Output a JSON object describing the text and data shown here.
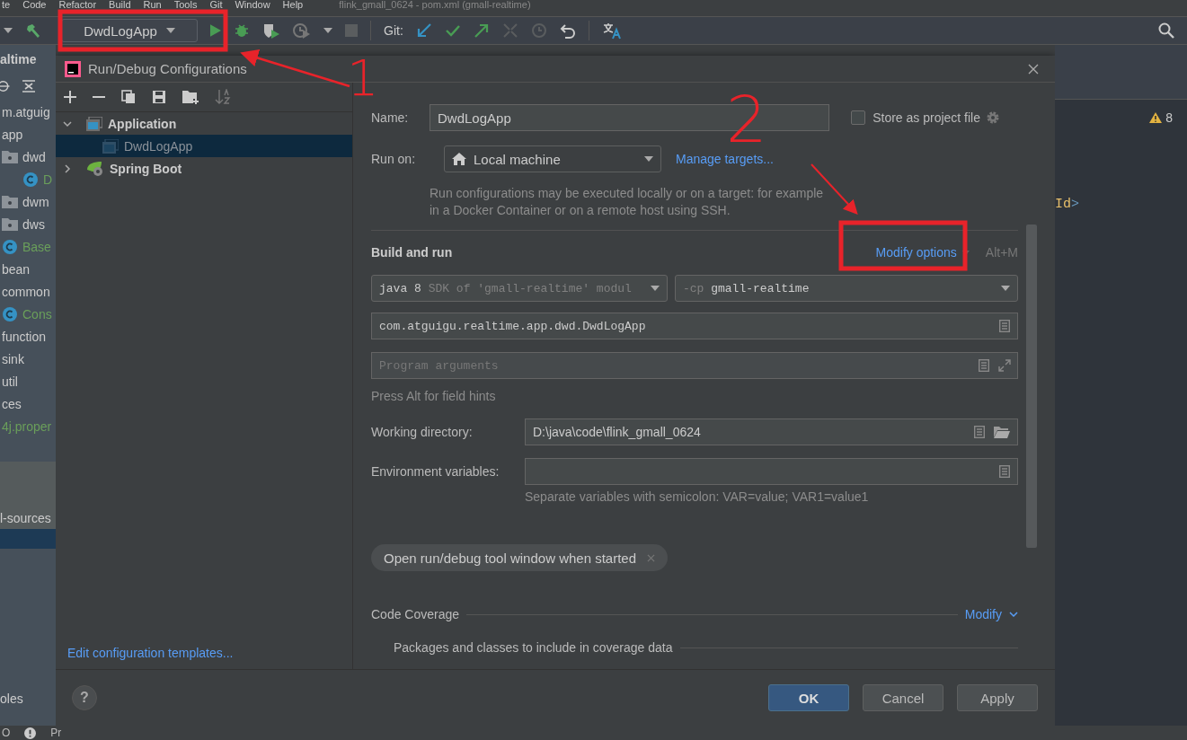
{
  "menu_bar": {
    "items": [
      "te",
      "Code",
      "Refactor",
      "Build",
      "Run",
      "Tools",
      "Git",
      "Window",
      "Help"
    ],
    "title": "flink_gmall_0624 - pom.xml (gmall-realtime)"
  },
  "toolbar": {
    "run_configuration": "DwdLogApp",
    "git_label": "Git:"
  },
  "project_panel": {
    "breadcrumb": "altime",
    "items": [
      {
        "label": "m.atguig",
        "kind": "package"
      },
      {
        "label": "app",
        "kind": "package"
      },
      {
        "label": "dwd",
        "kind": "folder",
        "children": [
          {
            "label": "D",
            "kind": "class"
          }
        ]
      },
      {
        "label": "dwm",
        "kind": "folder"
      },
      {
        "label": "dws",
        "kind": "folder"
      },
      {
        "label": "Base",
        "kind": "class"
      },
      {
        "label": "bean",
        "kind": "package"
      },
      {
        "label": "common",
        "kind": "package"
      },
      {
        "label": "Cons",
        "kind": "class"
      },
      {
        "label": "function",
        "kind": "package"
      },
      {
        "label": "sink",
        "kind": "package"
      },
      {
        "label": "util",
        "kind": "package"
      },
      {
        "label": "ces",
        "kind": "package"
      },
      {
        "label": "4j.proper",
        "kind": "file"
      }
    ],
    "lower_label": "l-sources",
    "bottom_label": "oles"
  },
  "dialog": {
    "title": "Run/Debug Configurations",
    "tree": [
      {
        "label": "Application",
        "kind": "application",
        "expanded": true,
        "selected": false,
        "children": [
          {
            "label": "DwdLogApp",
            "kind": "application",
            "selected": true
          }
        ]
      },
      {
        "label": "Spring Boot",
        "kind": "spring",
        "expanded": false,
        "selected": false
      }
    ],
    "templates_link": "Edit configuration templates...",
    "name_label": "Name:",
    "name_value": "DwdLogApp",
    "store_as_project_file": {
      "label": "Store as project file",
      "checked": false
    },
    "run_on_label": "Run on:",
    "run_on_value": "Local machine",
    "manage_targets": "Manage targets...",
    "run_on_hint": "Run configurations may be executed locally or on a target: for example in a Docker Container or on a remote host using SSH.",
    "section_title": "Build and run",
    "modify_options": "Modify options",
    "modify_shortcut": "Alt+M",
    "jdk": {
      "value": "java 8",
      "detail": "SDK of 'gmall-realtime' modul"
    },
    "classpath": {
      "prefix": "-cp",
      "value": "gmall-realtime"
    },
    "main_class": "com.atguigu.realtime.app.dwd.DwdLogApp",
    "program_arguments": {
      "placeholder": "Program arguments"
    },
    "field_hint": "Press Alt for field hints",
    "working_directory": {
      "label": "Working directory:",
      "value": "D:\\java\\code\\flink_gmall_0624"
    },
    "environment_variables": {
      "label": "Environment variables:",
      "hint": "Separate variables with semicolon: VAR=value; VAR1=value1"
    },
    "option_chip": "Open run/debug tool window when started",
    "code_coverage": {
      "title": "Code Coverage",
      "modify": "Modify",
      "subtitle": "Packages and classes to include in coverage data"
    },
    "help_label": "?",
    "buttons": [
      {
        "label": "OK",
        "kind": "primary"
      },
      {
        "label": "Cancel",
        "kind": "normal"
      },
      {
        "label": "Apply",
        "kind": "normal"
      }
    ]
  },
  "editor": {
    "warning_count": "8",
    "code_fragment": "Id",
    "code_bracket": ">"
  },
  "status_bar": {
    "items": [
      "O",
      "Pr"
    ]
  },
  "annotation_labels": [
    "1",
    "2"
  ]
}
